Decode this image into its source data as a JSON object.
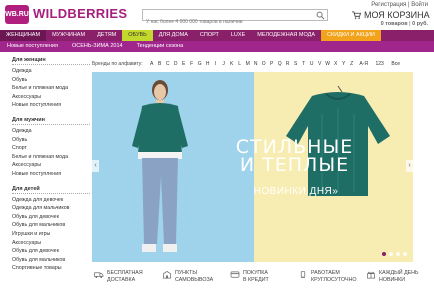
{
  "header": {
    "logo_badge": "WB.RU",
    "logo_text": "WILDBERRIES",
    "search_placeholder": "У нас более 4 000 000 товаров в наличии",
    "register_label": "Регистрация",
    "separator": "|",
    "login_label": "Войти",
    "cart_title": "МОЯ КОРЗИНА",
    "cart_count": "0 товаров",
    "cart_total": "0 руб."
  },
  "nav": {
    "items": [
      {
        "label": "ЖЕНЩИНАМ",
        "style": "active"
      },
      {
        "label": "МУЖЧИНАМ",
        "style": ""
      },
      {
        "label": "ДЕТЯМ",
        "style": ""
      },
      {
        "label": "ОБУВЬ",
        "style": "green"
      },
      {
        "label": "ДЛЯ ДОМА",
        "style": ""
      },
      {
        "label": "СПОРТ",
        "style": ""
      },
      {
        "label": "LUXE",
        "style": ""
      },
      {
        "label": "МЕЛОДЕЖНАЯ МОДА",
        "style": ""
      },
      {
        "label": "СКИДКИ И АКЦИИ",
        "style": "orange"
      }
    ]
  },
  "subnav": {
    "items": [
      "Новые поступления",
      "ОСЕНЬ-ЗИМА 2014",
      "Тенденции сезона"
    ]
  },
  "sidebar": {
    "groups": [
      {
        "title": "Для женщин",
        "links": [
          "Одежда",
          "Обувь",
          "Белье и пляжная мода",
          "Аксессуары",
          "Новые поступления"
        ]
      },
      {
        "title": "Для мужчин",
        "links": [
          "Одежда",
          "Обувь",
          "Спорт",
          "Белье и пляжная мода",
          "Аксессуары",
          "Новые поступления"
        ]
      },
      {
        "title": "Для детей",
        "links": [
          "Одежда для девочек",
          "Одежда для мальчиков",
          "Обувь для девочек",
          "Обувь для мальчиков",
          "Игрушки и игры",
          "Аксессуары",
          "Обувь для девочек",
          "Обувь для мальчиков",
          "Спортивные товары"
        ]
      }
    ]
  },
  "brands": {
    "label": "Бренды по алфавиту:",
    "letters": [
      "A",
      "B",
      "C",
      "D",
      "E",
      "F",
      "G",
      "H",
      "I",
      "J",
      "K",
      "L",
      "M",
      "N",
      "O",
      "P",
      "Q",
      "R",
      "S",
      "T",
      "U",
      "V",
      "W",
      "X",
      "Y",
      "Z",
      "А-Я",
      "123",
      "Все"
    ]
  },
  "banner": {
    "headline_line1": "СТИЛЬНЫЕ",
    "headline_line2": "И ТЕПЛЫЕ",
    "subhead": "НОВИНКИ ДНЯ»",
    "left_color": "#9fd2eb",
    "right_color": "#f7ecb1",
    "sweater_color": "#1f6e66"
  },
  "features": [
    {
      "icon": "truck-icon",
      "line1": "БЕСПЛАТНАЯ",
      "line2": "ДОСТАВКА"
    },
    {
      "icon": "pickup-point-icon",
      "line1": "ПУНКТЫ",
      "line2": "САМОВЫВОЗА"
    },
    {
      "icon": "credit-card-icon",
      "line1": "ПОКУПКА",
      "line2": "В КРЕДИТ"
    },
    {
      "icon": "phone-icon",
      "line1": "РАБОТАЕМ",
      "line2": "КРУГЛОСУТОЧНО"
    },
    {
      "icon": "gift-icon",
      "line1": "КАЖДЫЙ ДЕНЬ",
      "line2": "НОВИНКИ"
    }
  ],
  "colors": {
    "brand": "#a71f7c",
    "nav": "#8a1f6a",
    "subnav": "#a0268b"
  }
}
